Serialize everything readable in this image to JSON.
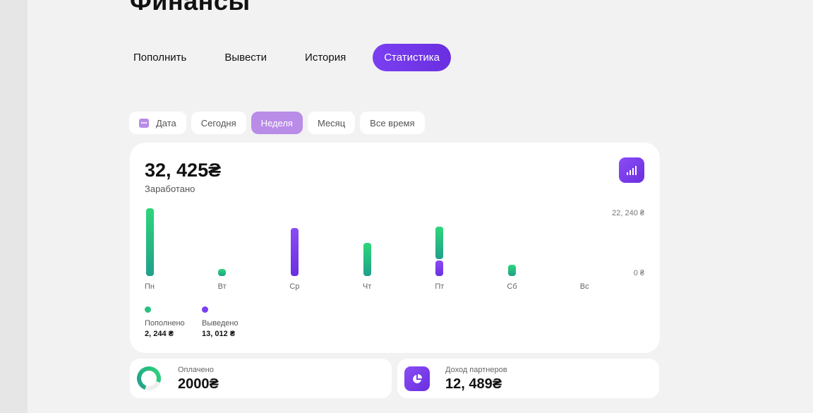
{
  "page": {
    "title": "Финансы"
  },
  "tabs": [
    {
      "label": "Пополнить"
    },
    {
      "label": "Вывести"
    },
    {
      "label": "История"
    },
    {
      "label": "Статистика",
      "active": true
    }
  ],
  "filters": [
    {
      "label": "Дата",
      "icon": "calendar-icon"
    },
    {
      "label": "Сегодня"
    },
    {
      "label": "Неделя",
      "active": true
    },
    {
      "label": "Месяц"
    },
    {
      "label": "Все время"
    }
  ],
  "summary": {
    "total": "32, 425₴",
    "label": "Заработано"
  },
  "chart_data": {
    "type": "bar",
    "categories": [
      "Пн",
      "Вт",
      "Ср",
      "Чт",
      "Пт",
      "Сб",
      "Вс"
    ],
    "series": [
      {
        "name": "Пополнено",
        "color": "#27c27f",
        "values": [
          22240,
          2400,
          0,
          10800,
          10700,
          3700,
          0
        ]
      },
      {
        "name": "Выведено",
        "color": "#7b3ff2",
        "values": [
          0,
          0,
          15700,
          0,
          5000,
          0,
          0
        ]
      }
    ],
    "ylim": [
      0,
      22240
    ],
    "y_ticks": [
      "22, 240 ₴",
      "0 ₴"
    ]
  },
  "legend": [
    {
      "label": "Пополнено",
      "value": "2, 244 ₴",
      "color": "#27c27f"
    },
    {
      "label": "Выведено",
      "value": "13, 012 ₴",
      "color": "#7b3ff2"
    }
  ],
  "stats": {
    "paid": {
      "label": "Оплачено",
      "value": "2000₴"
    },
    "partners": {
      "label": "Доход партнеров",
      "value": "12, 489₴"
    }
  },
  "colors": {
    "accent": "#7b3ff2",
    "accent_light": "#b98ce8",
    "green": "#27c27f",
    "background": "#f2f2f2"
  }
}
